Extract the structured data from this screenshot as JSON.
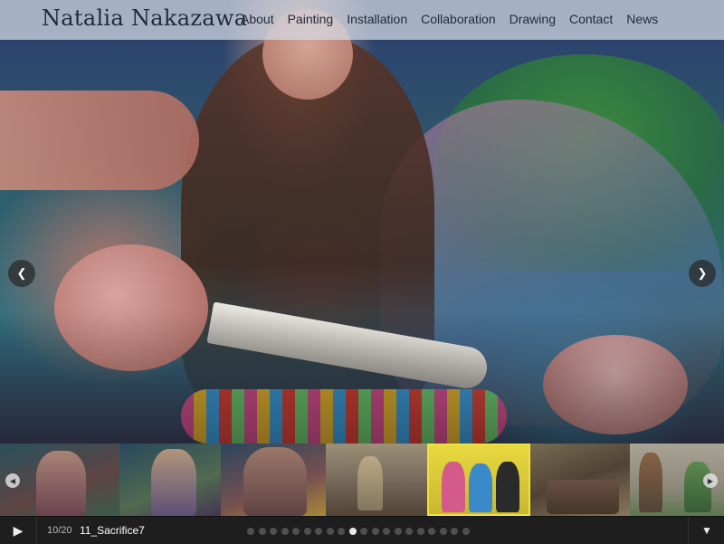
{
  "site": {
    "title": "Natalia Nakazawa"
  },
  "nav": {
    "items": [
      {
        "label": "About"
      },
      {
        "label": "Painting"
      },
      {
        "label": "Installation"
      },
      {
        "label": "Collaboration"
      },
      {
        "label": "Drawing"
      },
      {
        "label": "Contact"
      },
      {
        "label": "News"
      }
    ]
  },
  "slider": {
    "prev_icon": "chevron-left-icon",
    "next_icon": "chevron-right-icon",
    "counter": "10/20",
    "caption": "11_Sacrifice7",
    "total_slides": 20,
    "current_slide": 10
  },
  "controls": {
    "play_icon": "play-icon",
    "expand_icon": "caret-down-icon",
    "accent": "#f1e23a"
  },
  "thumbnails": [
    {
      "name": "thumb-1"
    },
    {
      "name": "thumb-2"
    },
    {
      "name": "thumb-3"
    },
    {
      "name": "thumb-4"
    },
    {
      "name": "thumb-5"
    },
    {
      "name": "thumb-6"
    },
    {
      "name": "thumb-7"
    }
  ]
}
